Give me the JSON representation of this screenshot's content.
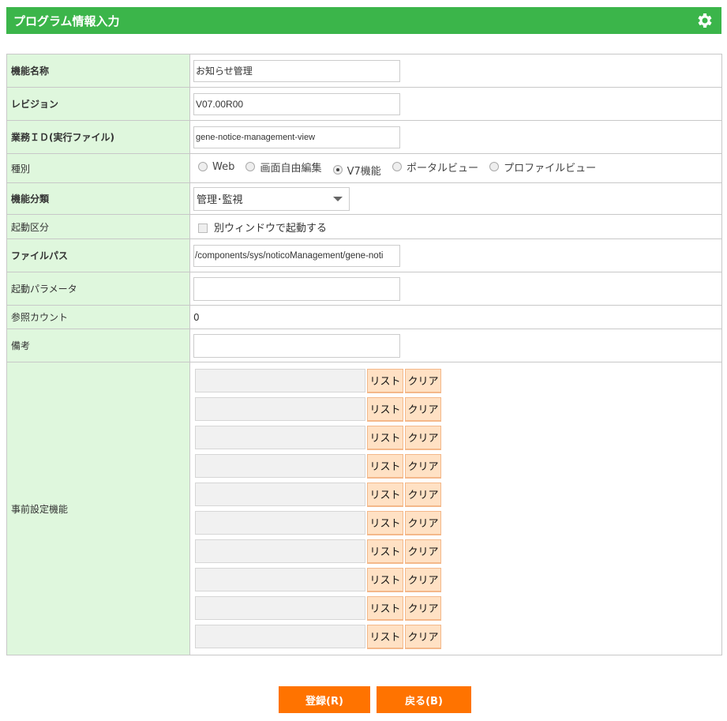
{
  "header": {
    "title": "プログラム情報入力"
  },
  "rows": {
    "name": {
      "label": "機能名称",
      "value": "お知らせ管理"
    },
    "revision": {
      "label": "レビジョン",
      "value": "V07.00R00"
    },
    "business_id": {
      "label": "業務ＩＤ(実行ファイル)",
      "value": "gene-notice-management-view"
    },
    "type": {
      "label": "種別",
      "options": [
        "Web",
        "画面自由編集",
        "V7機能",
        "ポータルビュー",
        "プロファイルビュー"
      ],
      "selected": "V7機能"
    },
    "category": {
      "label": "機能分類",
      "value": "管理･監視"
    },
    "launch": {
      "label": "起動区分",
      "checkbox_label": "別ウィンドウで起動する",
      "checked": false
    },
    "file_path": {
      "label": "ファイルパス",
      "value": "/components/sys/noticoManagement/gene-noti"
    },
    "params": {
      "label": "起動パラメータ",
      "value": ""
    },
    "ref_count": {
      "label": "参照カウント",
      "value": "0"
    },
    "notes": {
      "label": "備考",
      "value": ""
    },
    "preset": {
      "label": "事前設定機能",
      "list_label": "リスト",
      "clear_label": "クリア",
      "count": 10
    }
  },
  "footer": {
    "register_label": "登録(R)",
    "back_label": "戻る(B)"
  },
  "colors": {
    "header": "#3bb54a",
    "label_bg": "#dff7dd",
    "button": "#ff7300",
    "small_button": "#ffe1c4"
  }
}
